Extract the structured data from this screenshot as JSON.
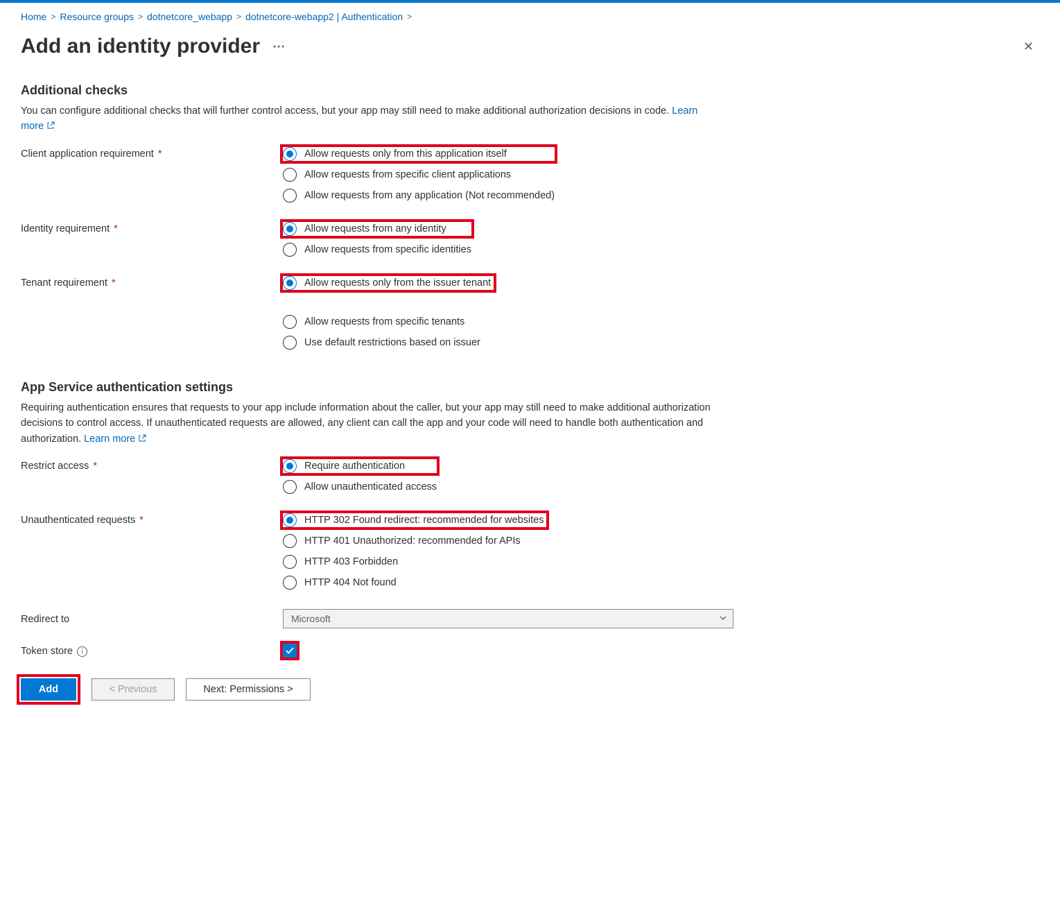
{
  "breadcrumbs": {
    "items": [
      {
        "label": "Home"
      },
      {
        "label": "Resource groups"
      },
      {
        "label": "dotnetcore_webapp"
      },
      {
        "label": "dotnetcore-webapp2 | Authentication"
      }
    ]
  },
  "header": {
    "title": "Add an identity provider"
  },
  "section1": {
    "title": "Additional checks",
    "desc1": "You can configure additional checks that will further control access, but your app may still need to make additional authorization decisions in code. ",
    "learn_more": "Learn more",
    "client_req_label": "Client application requirement",
    "client_req_options": {
      "o1": "Allow requests only from this application itself",
      "o2": "Allow requests from specific client applications",
      "o3": "Allow requests from any application (Not recommended)"
    },
    "identity_req_label": "Identity requirement",
    "identity_req_options": {
      "o1": "Allow requests from any identity",
      "o2": "Allow requests from specific identities"
    },
    "tenant_req_label": "Tenant requirement",
    "tenant_req_options": {
      "o1": "Allow requests only from the issuer tenant",
      "o2": "Allow requests from specific tenants",
      "o3": "Use default restrictions based on issuer"
    }
  },
  "section2": {
    "title": "App Service authentication settings",
    "desc": "Requiring authentication ensures that requests to your app include information about the caller, but your app may still need to make additional authorization decisions to control access. If unauthenticated requests are allowed, any client can call the app and your code will need to handle both authentication and authorization. ",
    "learn_more": "Learn more",
    "restrict_label": "Restrict access",
    "restrict_options": {
      "o1": "Require authentication",
      "o2": "Allow unauthenticated access"
    },
    "unauth_label": "Unauthenticated requests",
    "unauth_options": {
      "o1": "HTTP 302 Found redirect: recommended for websites",
      "o2": "HTTP 401 Unauthorized: recommended for APIs",
      "o3": "HTTP 403 Forbidden",
      "o4": "HTTP 404 Not found"
    },
    "redirect_label": "Redirect to",
    "redirect_value": "Microsoft",
    "token_store_label": "Token store"
  },
  "footer": {
    "add": "Add",
    "prev": "<  Previous",
    "next": "Next: Permissions  >"
  }
}
